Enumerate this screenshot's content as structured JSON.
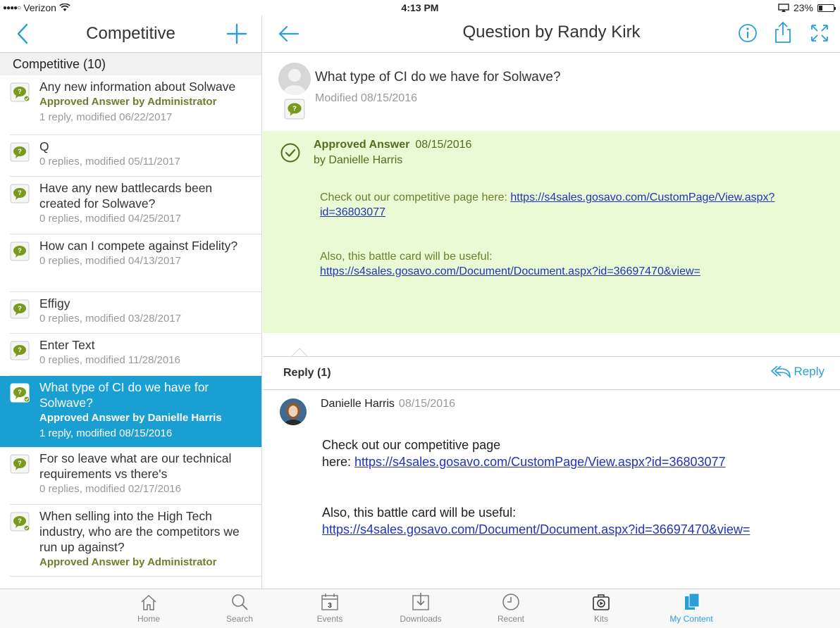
{
  "status_bar": {
    "carrier": "Verizon",
    "time": "4:13 PM",
    "battery": "23%",
    "battery_level": 0.23
  },
  "left": {
    "title": "Competitive",
    "section": "Competitive (10)",
    "items": [
      {
        "title": "Any new information about Solwave",
        "approved": "Approved Answer by Administrator",
        "meta": "1 reply, modified 06/22/2017"
      },
      {
        "title": "Q",
        "approved": "",
        "meta": "0 replies, modified 05/11/2017"
      },
      {
        "title": "Have any new battlecards been created for Solwave?",
        "approved": "",
        "meta": "0 replies, modified 04/25/2017"
      },
      {
        "title": "How can I compete against Fidelity?",
        "approved": "",
        "meta": "0 replies, modified 04/13/2017"
      },
      {
        "title": "Effigy",
        "approved": "",
        "meta": "0 replies, modified 03/28/2017"
      },
      {
        "title": "Enter Text",
        "approved": "",
        "meta": "0 replies, modified 11/28/2016"
      },
      {
        "title": "What type of CI do we have for Solwave?",
        "approved": "Approved Answer by Danielle Harris",
        "meta": "1 reply, modified 08/15/2016"
      },
      {
        "title": "For so leave what are our technical requirements vs there's",
        "approved": "",
        "meta": "0 replies, modified 02/17/2016"
      },
      {
        "title": "When selling into the High Tech industry, who are the competitors we run up against?",
        "approved": "Approved Answer by Administrator",
        "meta": ""
      }
    ]
  },
  "right": {
    "title": "Question by Randy Kirk",
    "question": "What type of CI do we have for Solwave?",
    "modified": "Modified 08/15/2016",
    "answer": {
      "label": "Approved Answer",
      "date": "08/15/2016",
      "by": "by Danielle Harris",
      "line1": "Check out our competitive page here: ",
      "link1a": "https://s4sales.gosavo.com/CustomPage/View.aspx?",
      "link1b": "id=36803077",
      "line2": "Also, this battle card will be useful:",
      "link2": "https://s4sales.gosavo.com/Document/Document.aspx?id=36697470&view="
    },
    "reply_header": "Reply (1)",
    "reply_button": "Reply",
    "reply": {
      "name": "Danielle Harris",
      "date": "08/15/2016",
      "line1": "Check out our competitive page",
      "line1b": "here: ",
      "link1": "https://s4sales.gosavo.com/CustomPage/View.aspx?id=36803077",
      "line2": "Also, this battle card will be useful:",
      "link2": "https://s4sales.gosavo.com/Document/Document.aspx?id=36697470&view="
    }
  },
  "tabs": [
    {
      "label": "Home",
      "icon": "home-icon"
    },
    {
      "label": "Search",
      "icon": "search-icon"
    },
    {
      "label": "Events",
      "icon": "calendar-icon",
      "badge": "3"
    },
    {
      "label": "Downloads",
      "icon": "download-icon"
    },
    {
      "label": "Recent",
      "icon": "clock-icon"
    },
    {
      "label": "Kits",
      "icon": "kit-icon"
    },
    {
      "label": "My Content",
      "icon": "my-content-icon",
      "active": true
    }
  ],
  "colors": {
    "accent": "#2a9fd6",
    "selected": "#1a9fd3",
    "approved_text": "#6b7f2c",
    "answer_bg": "#e9fad4"
  }
}
